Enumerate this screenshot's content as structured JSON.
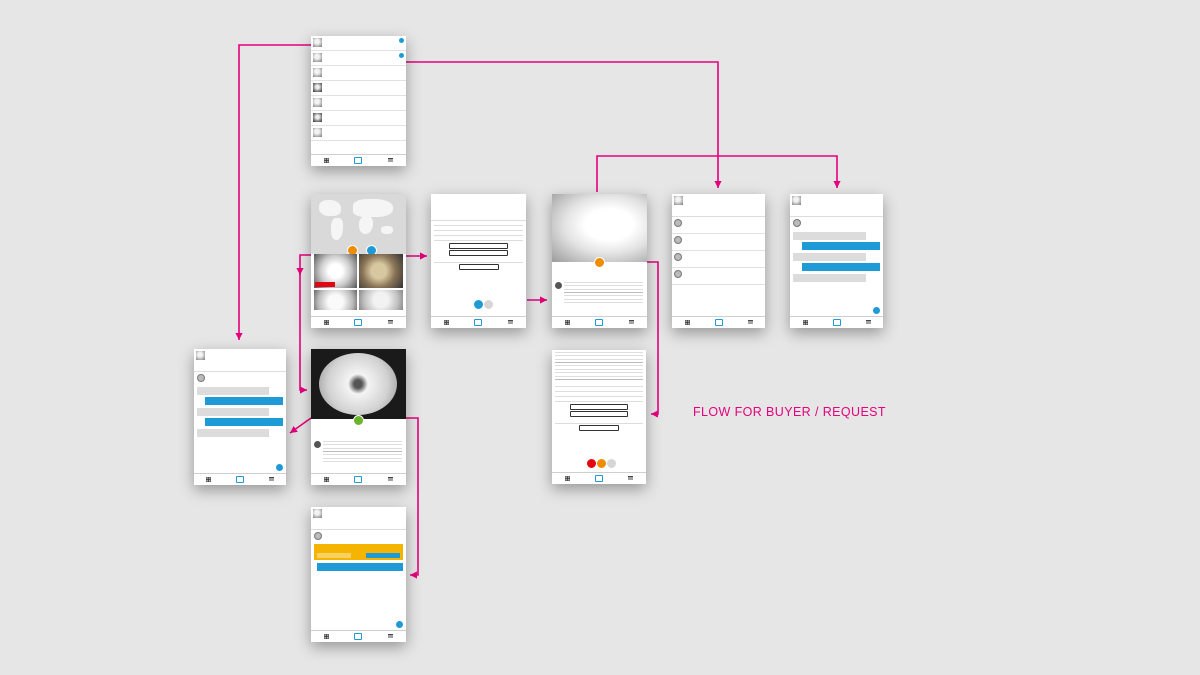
{
  "caption": "FLOW FOR BUYER / REQUEST",
  "colors": {
    "arrow": "#e6007e",
    "accent_blue": "#1e9bd7",
    "buy_green": "#6ab42d",
    "sell_orange": "#f08c00",
    "canvas": "#e6e6e6"
  },
  "nodes": [
    "screen-inbox-list",
    "screen-map-gallery",
    "screen-item-entry-form",
    "screen-request-detail",
    "screen-request-chat-list",
    "screen-request-chat-thread",
    "screen-buyer-chat",
    "screen-buy-detail",
    "screen-location-form",
    "screen-buy-confirm-chat"
  ],
  "edges": [
    [
      "screen-inbox-list",
      "screen-buyer-chat"
    ],
    [
      "screen-inbox-list",
      "screen-request-chat-list"
    ],
    [
      "screen-map-gallery",
      "screen-item-entry-form"
    ],
    [
      "screen-map-gallery",
      "screen-buy-detail"
    ],
    [
      "screen-item-entry-form",
      "screen-request-detail"
    ],
    [
      "screen-request-detail",
      "screen-request-chat-list"
    ],
    [
      "screen-request-detail",
      "screen-request-chat-thread"
    ],
    [
      "screen-request-detail",
      "screen-location-form"
    ],
    [
      "screen-buy-detail",
      "screen-buyer-chat"
    ],
    [
      "screen-buy-detail",
      "screen-buy-confirm-chat"
    ]
  ],
  "tab_icons": [
    "grid-icon",
    "dollar-icon",
    "menu-icon"
  ]
}
